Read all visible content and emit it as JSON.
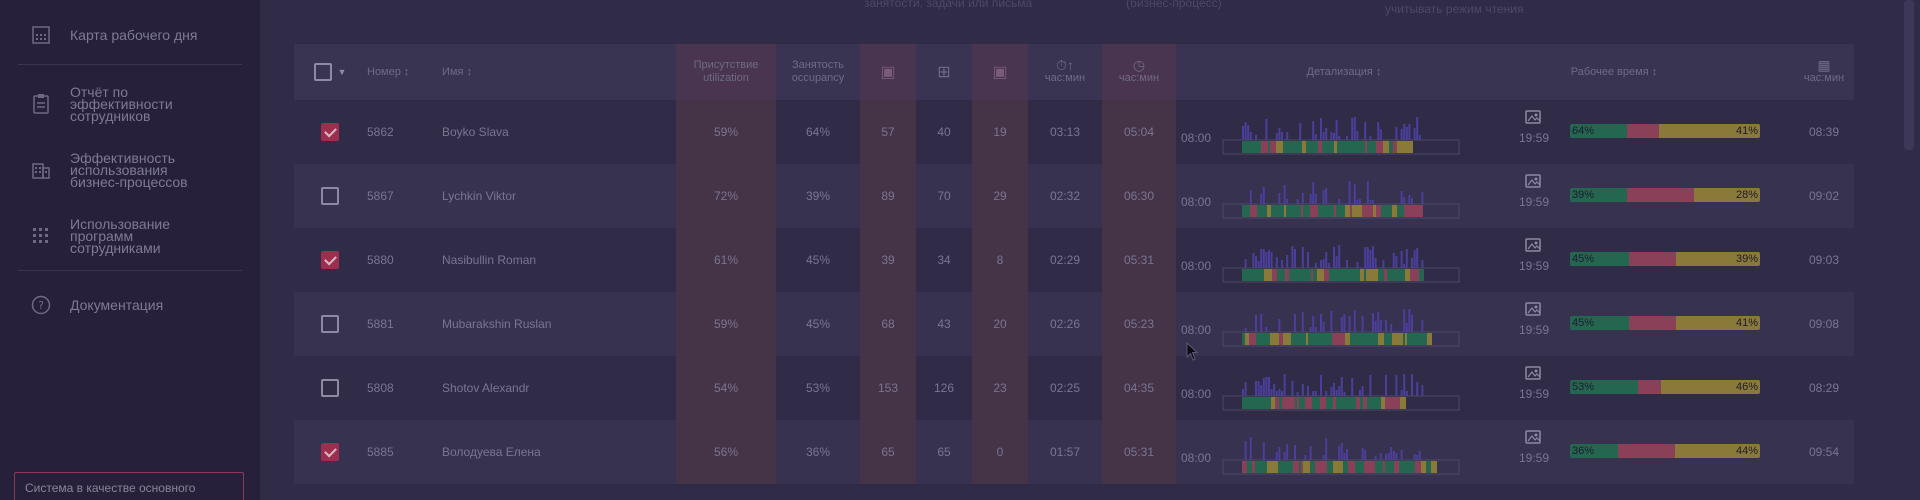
{
  "sidebar": {
    "items": [
      {
        "label": "Карта рабочего дня",
        "icon": "calendar-grid-icon"
      },
      {
        "label": "Отчёт по эффективности сотрудников",
        "icon": "clipboard-icon"
      },
      {
        "label": "Эффективность использования бизнес-процессов",
        "icon": "building-icon"
      },
      {
        "label": "Использование программ сотрудниками",
        "icon": "apps-grid-icon"
      },
      {
        "label": "Документация",
        "icon": "help-circle-icon"
      }
    ],
    "system_note": "Система в качестве основного"
  },
  "top_notes": {
    "note1": "занятости, задачи или письма",
    "note2": "(бизнес-процесс)",
    "note3": "учитывать режим чтения"
  },
  "table": {
    "headers": {
      "number": "Номер",
      "name": "Имя",
      "presence_1": "Присутствие",
      "presence_2": "utilization",
      "occupancy_1": "Занятость",
      "occupancy_2": "occupancy",
      "time_up_label": "час:мин",
      "time_label": "час:мин",
      "detail": "Детализация",
      "worktime": "Рабочее время",
      "date_label": "час:мин"
    },
    "rows": [
      {
        "checked": true,
        "number": "5862",
        "name": "Boyko Slava",
        "presence": "59%",
        "occupancy": "64%",
        "c1": "57",
        "c2": "40",
        "c3": "19",
        "t1": "03:13",
        "t2": "05:04",
        "start": "08:00",
        "end": "19:59",
        "wb_left": "64%",
        "wb_right": "41%",
        "total": "08:39",
        "g": 30,
        "r": 17,
        "y": 53
      },
      {
        "checked": false,
        "number": "5867",
        "name": "Lychkin Viktor",
        "presence": "72%",
        "occupancy": "39%",
        "c1": "89",
        "c2": "70",
        "c3": "29",
        "t1": "02:32",
        "t2": "06:30",
        "start": "08:00",
        "end": "19:59",
        "wb_left": "39%",
        "wb_right": "28%",
        "total": "09:02",
        "g": 30,
        "r": 35,
        "y": 35
      },
      {
        "checked": true,
        "number": "5880",
        "name": "Nasibullin Roman",
        "presence": "61%",
        "occupancy": "45%",
        "c1": "39",
        "c2": "34",
        "c3": "8",
        "t1": "02:29",
        "t2": "05:31",
        "start": "08:00",
        "end": "19:59",
        "wb_left": "45%",
        "wb_right": "39%",
        "total": "09:03",
        "g": 31,
        "r": 25,
        "y": 44
      },
      {
        "checked": false,
        "number": "5881",
        "name": "Mubarakshin Ruslan",
        "presence": "59%",
        "occupancy": "45%",
        "c1": "68",
        "c2": "43",
        "c3": "20",
        "t1": "02:26",
        "t2": "05:23",
        "start": "08:00",
        "end": "19:59",
        "wb_left": "45%",
        "wb_right": "41%",
        "total": "09:08",
        "g": 31,
        "r": 25,
        "y": 44
      },
      {
        "checked": false,
        "number": "5808",
        "name": "Shotov Alexandr",
        "presence": "54%",
        "occupancy": "53%",
        "c1": "153",
        "c2": "126",
        "c3": "23",
        "t1": "02:25",
        "t2": "04:35",
        "start": "08:00",
        "end": "19:59",
        "wb_left": "53%",
        "wb_right": "46%",
        "total": "08:29",
        "g": 36,
        "r": 12,
        "y": 52
      },
      {
        "checked": true,
        "number": "5885",
        "name": "Володуева Елена",
        "presence": "56%",
        "occupancy": "36%",
        "c1": "65",
        "c2": "65",
        "c3": "0",
        "t1": "01:57",
        "t2": "05:31",
        "start": "08:00",
        "end": "19:59",
        "wb_left": "36%",
        "wb_right": "44%",
        "total": "09:54",
        "g": 25,
        "r": 30,
        "y": 45
      }
    ]
  }
}
